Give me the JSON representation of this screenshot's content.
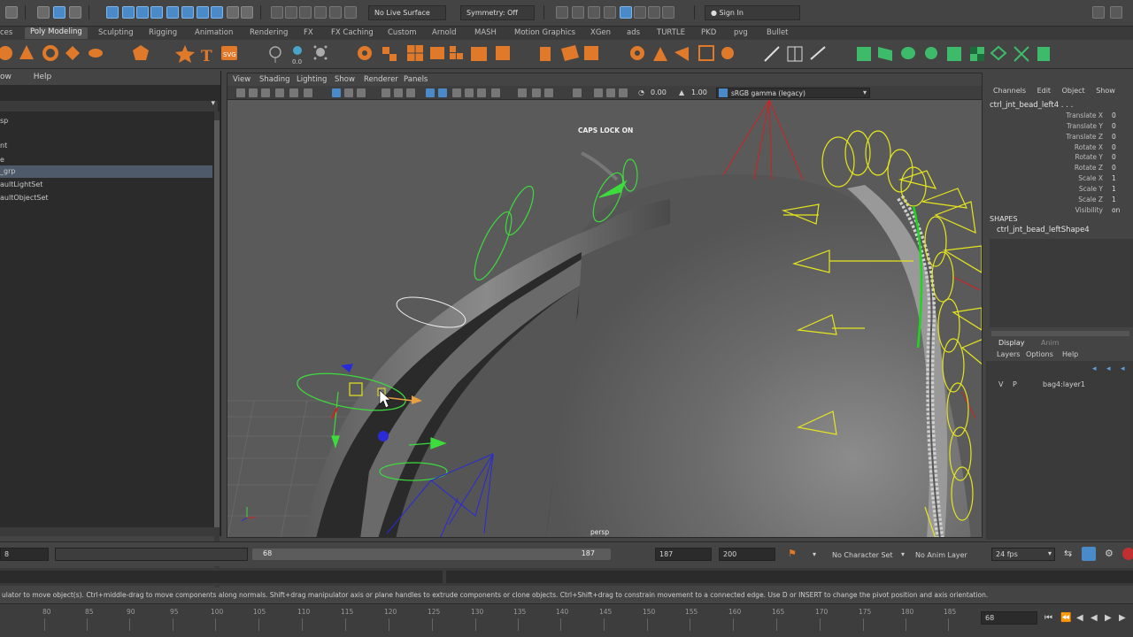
{
  "status_line": {
    "live_surface": "No Live Surface",
    "symmetry": "Symmetry: Off",
    "sign_in": "Sign In"
  },
  "shelf_tabs": [
    "ces",
    "Poly Modeling",
    "Sculpting",
    "Rigging",
    "Animation",
    "Rendering",
    "FX",
    "FX Caching",
    "Custom",
    "Arnold",
    "MASH",
    "Motion Graphics",
    "XGen",
    "ads",
    "TURTLE",
    "PKD",
    "pvg",
    "Bullet"
  ],
  "outliner": {
    "menu": [
      "ow",
      "Help"
    ],
    "items": [
      "sp",
      "nt",
      "e",
      "_grp",
      "aultLightSet",
      "aultObjectSet"
    ],
    "selected_index": 3
  },
  "viewport": {
    "menu": [
      "View",
      "Shading",
      "Lighting",
      "Show",
      "Renderer",
      "Panels"
    ],
    "exposure": "0.00",
    "gamma": "1.00",
    "color_space": "sRGB gamma (legacy)",
    "caps_lock": "CAPS LOCK ON",
    "camera": "persp"
  },
  "channel_box": {
    "menu": [
      "Channels",
      "Edit",
      "Object",
      "Show"
    ],
    "object_name": "ctrl_jnt_bead_left4 . . .",
    "attributes": [
      {
        "name": "Translate X",
        "value": "0"
      },
      {
        "name": "Translate Y",
        "value": "0"
      },
      {
        "name": "Translate Z",
        "value": "0"
      },
      {
        "name": "Rotate X",
        "value": "0"
      },
      {
        "name": "Rotate Y",
        "value": "0"
      },
      {
        "name": "Rotate Z",
        "value": "0"
      },
      {
        "name": "Scale X",
        "value": "1"
      },
      {
        "name": "Scale Y",
        "value": "1"
      },
      {
        "name": "Scale Z",
        "value": "1"
      },
      {
        "name": "Visibility",
        "value": "on"
      }
    ],
    "shapes_label": "SHAPES",
    "shape_name": "ctrl_jnt_bead_leftShape4"
  },
  "layer_editor": {
    "tabs": [
      "Display",
      "Anim"
    ],
    "menu": [
      "Layers",
      "Options",
      "Help"
    ],
    "layer": {
      "v": "V",
      "p": "P",
      "name": "bag4:layer1"
    }
  },
  "time_bar": {
    "start": "8",
    "range_start": "68",
    "range_end": "187",
    "end_a": "187",
    "end_b": "200",
    "character_set": "No Character Set",
    "anim_layer": "No Anim Layer",
    "fps": "24 fps"
  },
  "help_line": "ulator to move object(s). Ctrl+middle-drag to move components along normals. Shift+drag manipulator axis or plane handles to extrude components or clone objects. Ctrl+Shift+drag to constrain movement to a connected edge. Use D or INSERT to change the pivot position and axis orientation.",
  "timeline": {
    "ticks": [
      "80",
      "85",
      "90",
      "95",
      "100",
      "105",
      "110",
      "115",
      "120",
      "125",
      "130",
      "135",
      "140",
      "145",
      "150",
      "155",
      "160",
      "165",
      "170",
      "175",
      "180",
      "185"
    ],
    "current_frame": "68"
  },
  "colors": {
    "accent": "#4a8ac8",
    "wire_yellow": "#e6e61e",
    "wire_green": "#3ddc3d",
    "wire_red": "#d22020",
    "wire_blue": "#2a2ad8"
  }
}
